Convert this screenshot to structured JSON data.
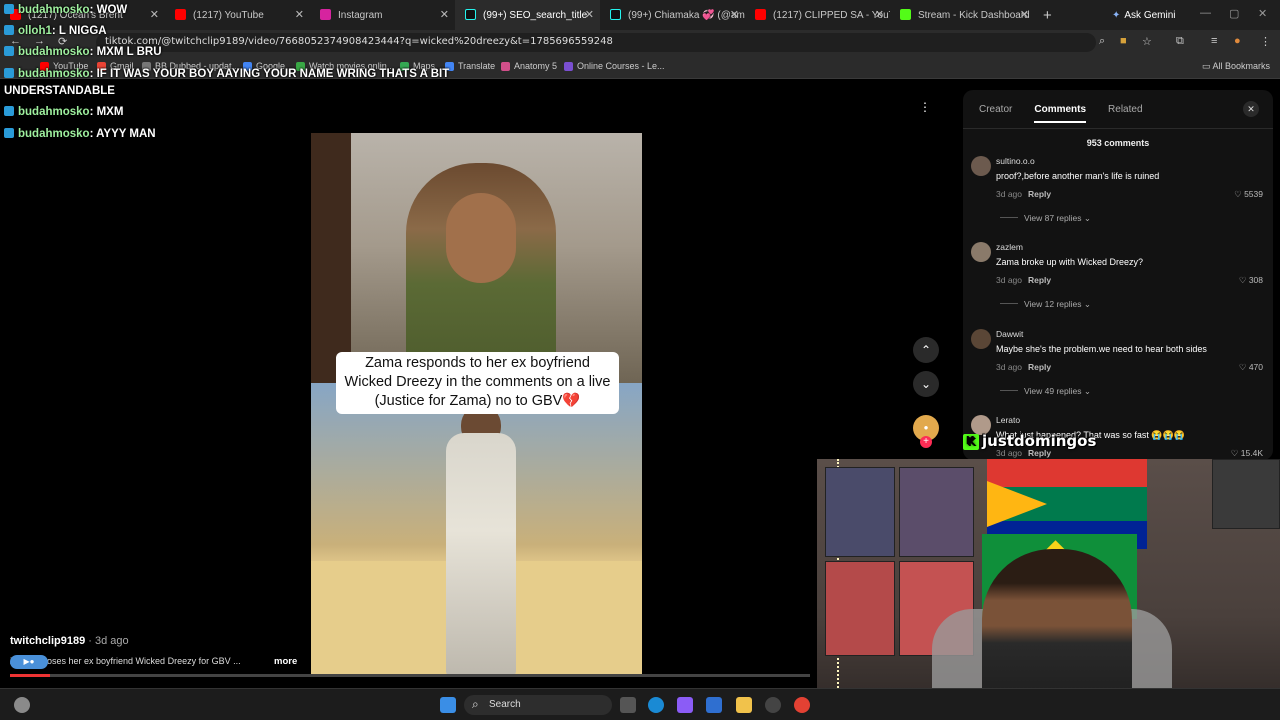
{
  "browser": {
    "tabs": [
      {
        "label": "(1217) Ocean's Brent",
        "color": "#ff0000"
      },
      {
        "label": "(1217) YouTube",
        "color": "#ff0000"
      },
      {
        "label": "Instagram",
        "color": "#d6249f"
      },
      {
        "label": "(99+) SEO_search_title",
        "color": "#25f4ee",
        "active": true
      },
      {
        "label": "(99+) Chiamaka 💞 (@ama...",
        "color": "#25f4ee"
      },
      {
        "label": "(1217) CLIPPED SA - YouTu...",
        "color": "#ff0000"
      },
      {
        "label": "Stream - Kick Dashboard",
        "color": "#53fc18"
      }
    ],
    "new_tab": "+",
    "ask_gemini": "Ask Gemini",
    "url": "tiktok.com/@twitchclip9189/video/7668052374908423444?q=wicked%20dreezy&t=1785696559248",
    "bookmarks": [
      "YouTube",
      "Gmail",
      "BB Dubbed - updat...",
      "Google",
      "Watch movies onlin...",
      "Maps",
      "Translate",
      "Anatomy 5",
      "Online Courses - Le..."
    ],
    "all_bookmarks": "All Bookmarks"
  },
  "chat_overlay": [
    {
      "user": "budahmosko",
      "text": ": WOW"
    },
    {
      "user": "olloh1",
      "text": ": L NIGGA"
    },
    {
      "user": "budahmosko",
      "text": ": MXM L BRU"
    },
    {
      "user": "budahmosko",
      "text": ": IF IT WAS YOUR BOY AAYING YOUR NAME WRING THATS A BIT"
    },
    {
      "user": "",
      "text": "UNDERSTANDABLE"
    },
    {
      "user": "budahmosko",
      "text": ": MXM"
    },
    {
      "user": "budahmosko",
      "text": ": AYYY MAN"
    }
  ],
  "video": {
    "caption": "Zama responds to her ex boyfriend Wicked Dreezy in the comments on a live (Justice for Zama) no to GBV💔",
    "author": "twitchclip9189",
    "ago": " · 3d ago",
    "description": "Zami exposes her ex boyfriend Wicked Dreezy for GBV ...",
    "more": "more",
    "progress": 0.05
  },
  "panel": {
    "tabs": [
      "Creator",
      "Comments",
      "Related"
    ],
    "active_tab": "Comments",
    "comment_count": "953 comments",
    "comments": [
      {
        "user": "sultino.o.o",
        "text": "proof?,before another man's life is ruined",
        "time": "3d ago",
        "reply": "Reply",
        "likes": "5539",
        "replies": "View 87 replies ⌄"
      },
      {
        "user": "zazlem",
        "text": "Zama broke up with Wicked Dreezy?",
        "time": "3d ago",
        "reply": "Reply",
        "likes": "308",
        "replies": "View 12 replies ⌄"
      },
      {
        "user": "Dawwit",
        "text": "Maybe she's the problem.we need to hear both sides",
        "time": "3d ago",
        "reply": "Reply",
        "likes": "470",
        "replies": "View 49 replies ⌄"
      },
      {
        "user": "Lerato",
        "text": "What just happened? That was so fast 😭😭😭",
        "time": "3d ago",
        "reply": "Reply",
        "likes": "15.4K",
        "replies": ""
      }
    ]
  },
  "streamer_overlay": {
    "name": "justdomingos"
  },
  "taskbar": {
    "search": "Search"
  }
}
